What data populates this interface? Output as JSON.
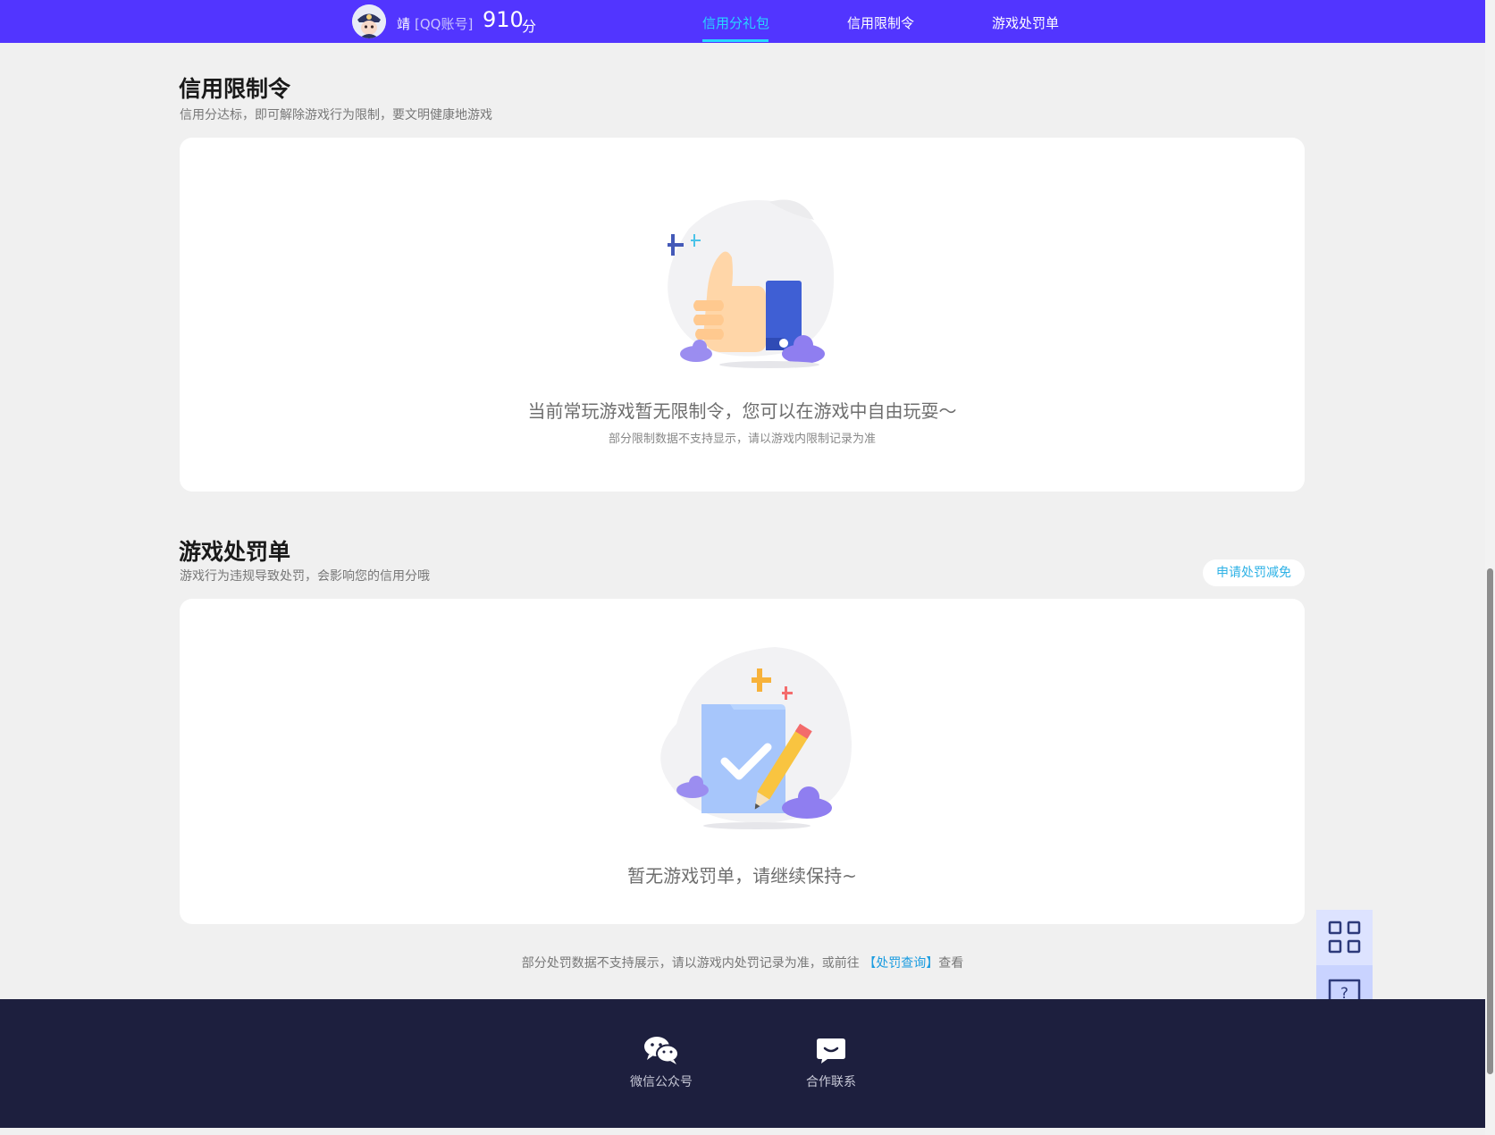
{
  "header": {
    "user_name": "靖",
    "account_type": "[QQ账号]",
    "score": "910",
    "score_unit": "分",
    "tabs": [
      {
        "label": "信用分礼包",
        "active": true
      },
      {
        "label": "信用限制令",
        "active": false
      },
      {
        "label": "游戏处罚单",
        "active": false
      }
    ]
  },
  "restriction": {
    "title": "信用限制令",
    "subtitle": "信用分达标，即可解除游戏行为限制，要文明健康地游戏",
    "empty_text": "当前常玩游戏暂无限制令，您可以在游戏中自由玩耍～",
    "note": "部分限制数据不支持显示，请以游戏内限制记录为准"
  },
  "penalty": {
    "title": "游戏处罚单",
    "subtitle": "游戏行为违规导致处罚，会影响您的信用分哦",
    "apply_button": "申请处罚减免",
    "empty_text": "暂无游戏罚单，请继续保持~"
  },
  "footnote": {
    "prefix": "部分处罚数据不支持展示，请以游戏内处罚记录为准，或前往",
    "link": "【处罚查询】",
    "suffix": "查看"
  },
  "footer": {
    "items": [
      {
        "label": "微信公众号",
        "icon": "wechat-icon"
      },
      {
        "label": "合作联系",
        "icon": "chat-bubble-icon"
      }
    ]
  },
  "side_tools": [
    {
      "icon": "qr-code-icon"
    },
    {
      "icon": "help-question-icon"
    }
  ],
  "colors": {
    "header_bg": "#5235ff",
    "active_tab": "#27d8ff",
    "footer_bg": "#1d1f3e",
    "link": "#1b9ce0"
  }
}
